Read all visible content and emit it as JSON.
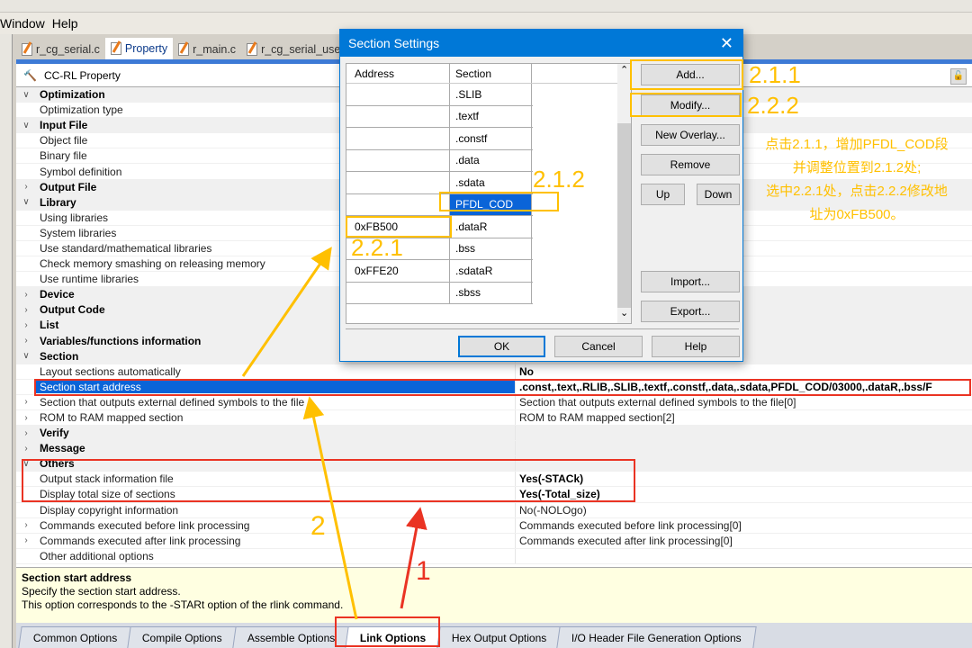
{
  "menu": [
    "Window",
    "Help"
  ],
  "file_tabs": [
    {
      "label": "r_cg_serial.c"
    },
    {
      "label": "Property",
      "active": true
    },
    {
      "label": "r_main.c"
    },
    {
      "label": "r_cg_serial_user.c"
    }
  ],
  "panel_title": "CC-RL Property",
  "properties": [
    {
      "name": "Optimization",
      "cat": true,
      "open": true
    },
    {
      "name": "Optimization type"
    },
    {
      "name": "Input File",
      "cat": true,
      "open": true
    },
    {
      "name": "Object file"
    },
    {
      "name": "Binary file"
    },
    {
      "name": "Symbol definition"
    },
    {
      "name": "Output File",
      "cat": true,
      "open": false
    },
    {
      "name": "Library",
      "cat": true,
      "open": true
    },
    {
      "name": "Using libraries"
    },
    {
      "name": "System libraries"
    },
    {
      "name": "Use standard/mathematical libraries"
    },
    {
      "name": "Check memory smashing on releasing memory"
    },
    {
      "name": "Use runtime libraries"
    },
    {
      "name": "Device",
      "cat": true,
      "open": false
    },
    {
      "name": "Output Code",
      "cat": true,
      "open": false
    },
    {
      "name": "List",
      "cat": true,
      "open": false
    },
    {
      "name": "Variables/functions information",
      "cat": true,
      "open": false
    },
    {
      "name": "Section",
      "cat": true,
      "open": true
    },
    {
      "name": "Layout sections automatically",
      "value": "No",
      "bold": true
    },
    {
      "name": "Section start address",
      "value": ".const,.text,.RLIB,.SLIB,.textf,.constf,.data,.sdata,PFDL_COD/03000,.dataR,.bss/F",
      "sel": true
    },
    {
      "name": "Section that outputs external defined symbols to the file",
      "value": "Section that outputs external defined symbols to the file[0]",
      "sub": true
    },
    {
      "name": "ROM to RAM mapped section",
      "value": "ROM to RAM mapped section[2]",
      "sub": true
    },
    {
      "name": "Verify",
      "cat": true,
      "open": false
    },
    {
      "name": "Message",
      "cat": true,
      "open": false
    },
    {
      "name": "Others",
      "cat": true,
      "open": true
    },
    {
      "name": "Output stack information file",
      "value": "Yes(-STACk)",
      "bold": true
    },
    {
      "name": "Display total size of sections",
      "value": "Yes(-Total_size)",
      "bold": true
    },
    {
      "name": "Display copyright information",
      "value": "No(-NOLOgo)"
    },
    {
      "name": "Commands executed before link processing",
      "value": "Commands executed before link processing[0]",
      "sub": true
    },
    {
      "name": "Commands executed after link processing",
      "value": "Commands executed after link processing[0]",
      "sub": true
    },
    {
      "name": "Other additional options"
    }
  ],
  "description": {
    "title": "Section start address",
    "line1": "Specify the section start address.",
    "line2": "This option corresponds to the -STARt option of the rlink command."
  },
  "bottom_tabs": [
    {
      "label": "Common Options"
    },
    {
      "label": "Compile Options"
    },
    {
      "label": "Assemble Options"
    },
    {
      "label": "Link Options",
      "active": true
    },
    {
      "label": "Hex Output Options"
    },
    {
      "label": "I/O Header File Generation Options"
    }
  ],
  "dialog": {
    "title": "Section Settings",
    "columns": [
      "Address",
      "Section"
    ],
    "rows": [
      {
        "address": "",
        "section": ".SLIB"
      },
      {
        "address": "",
        "section": ".textf"
      },
      {
        "address": "",
        "section": ".constf"
      },
      {
        "address": "",
        "section": ".data"
      },
      {
        "address": "",
        "section": ".sdata"
      },
      {
        "address": "",
        "section": "PFDL_COD",
        "selected": true
      },
      {
        "address": "0xFB500",
        "section": ".dataR"
      },
      {
        "address": "",
        "section": ".bss"
      },
      {
        "address": "0xFFE20",
        "section": ".sdataR"
      },
      {
        "address": "",
        "section": ".sbss"
      }
    ],
    "buttons": {
      "add": "Add...",
      "modify": "Modify...",
      "new_overlay": "New Overlay...",
      "remove": "Remove",
      "up": "Up",
      "down": "Down",
      "import": "Import...",
      "export": "Export...",
      "ok": "OK",
      "cancel": "Cancel",
      "help": "Help"
    }
  },
  "annotations": {
    "a211": "2.1.1",
    "a222": "2.2.2",
    "a212": "2.1.2",
    "a221": "2.2.1",
    "step1": "1",
    "step2": "2",
    "note": [
      "点击2.1.1，增加PFDL_COD段",
      "并调整位置到2.1.2处;",
      "选中2.2.1处，点击2.2.2修改地",
      "址为0xFB500。"
    ]
  },
  "colors": {
    "accent": "#0078d7",
    "annotation_orange": "#ffc000",
    "annotation_red": "#ea3323",
    "selection": "#0a64d8"
  }
}
